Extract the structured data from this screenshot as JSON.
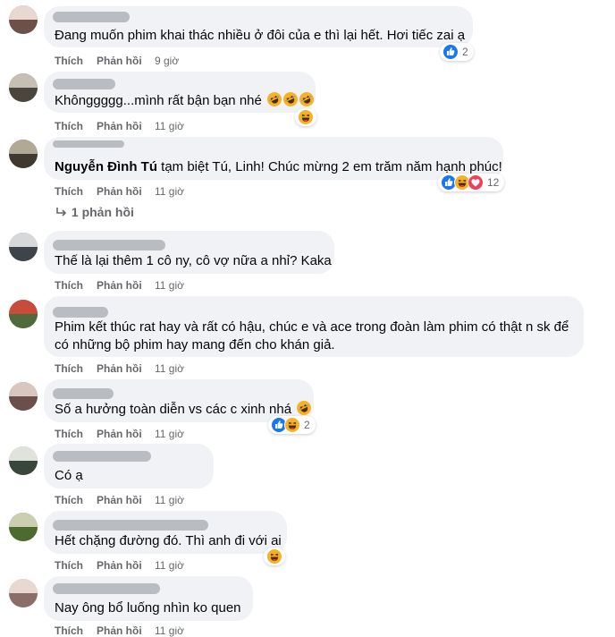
{
  "colors": {
    "bubble": "#f0f2f5",
    "meta_text": "#65676b",
    "like_blue": "#1877f2",
    "haha_yellow": "#f7b125",
    "love_red": "#f33e58"
  },
  "action_labels": {
    "like": "Thích",
    "reply": "Phản hồi"
  },
  "comments": [
    {
      "text": "Đang muốn phim khai thác nhiều ở đôi của e thì lại hết. Hơi tiếc zai ạ",
      "time": "9 giờ",
      "reaction_count": "2",
      "reactions": [
        "like-icon"
      ]
    },
    {
      "text": "Khônggggg...mình rất bận bạn nhé",
      "time": "11 giờ",
      "reactions": [
        "haha-icon"
      ]
    },
    {
      "name": "Nguyễn Đình Tú",
      "text": "tạm biệt Tú, Linh! Chúc mừng 2 em trăm năm hạnh phúc!",
      "time": "11 giờ",
      "reaction_count": "12",
      "reactions": [
        "like-icon",
        "haha-icon",
        "love-icon"
      ],
      "replies_link": "1 phản hồi"
    },
    {
      "text": "Thế là lại thêm 1 cô ny, cô vợ nữa a nhỉ? Kaka",
      "time": "11 giờ"
    },
    {
      "text_line1": "Phim kết thúc rat hay và rất có hậu, chúc e và ace trong đoàn làm phim có thật n sk để",
      "text_line2": "có những bộ phim hay mang đến cho khán giả.",
      "time": "11 giờ"
    },
    {
      "text": "Số a hưởng toàn diễn vs các c xinh nhá",
      "time": "11 giờ",
      "reaction_count": "2",
      "reactions": [
        "like-icon",
        "haha-icon"
      ]
    },
    {
      "text": "Có ạ",
      "time": "11 giờ"
    },
    {
      "text": "Hết chặng đường đó. Thì anh đi với ai",
      "time": "11 giờ",
      "reactions": [
        "haha-icon"
      ]
    },
    {
      "text": "Nay ông bổ luống nhìn ko quen",
      "time": "11 giờ"
    }
  ]
}
